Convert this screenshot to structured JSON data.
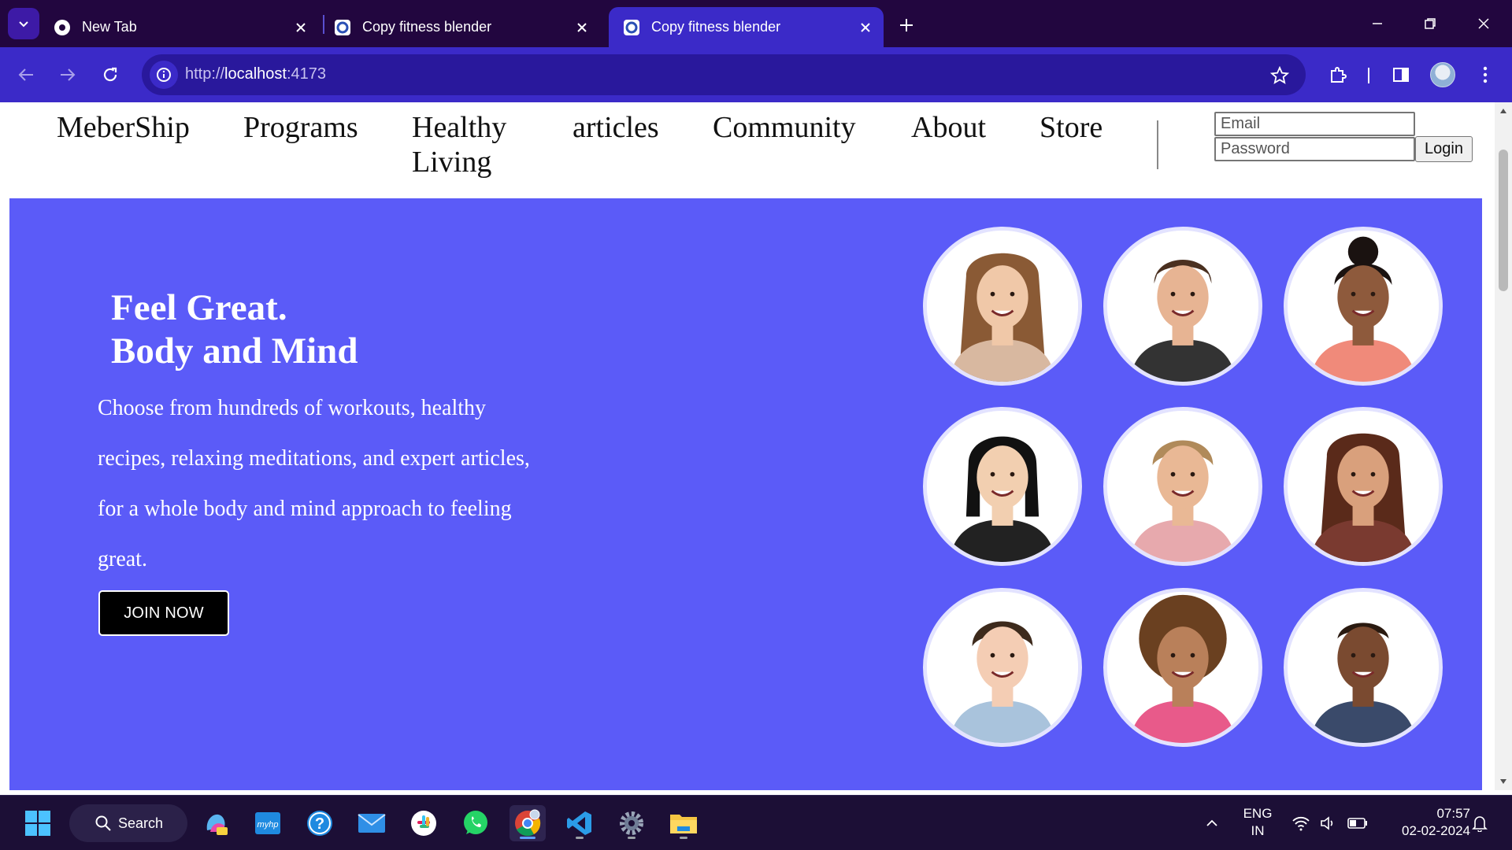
{
  "browser": {
    "tabs": [
      {
        "title": "New Tab",
        "active": false
      },
      {
        "title": "Copy fitness blender",
        "active": false
      },
      {
        "title": "Copy fitness blender",
        "active": true
      }
    ],
    "url_scheme": "http://",
    "url_host": "localhost",
    "url_port": ":4173"
  },
  "site": {
    "nav": [
      "MeberShip",
      "Programs",
      "Healthy",
      "Living",
      "articles",
      "Community",
      "About",
      "Store"
    ],
    "login": {
      "email_placeholder": "Email",
      "password_placeholder": "Password",
      "button": "Login"
    },
    "hero": {
      "title_line1": "Feel Great.",
      "title_line2": "Body and Mind",
      "description": "Choose from hundreds of workouts, healthy recipes, relaxing meditations, and expert articles, for a whole body and mind approach to feeling great.",
      "cta": "JOIN NOW",
      "background": "#5b5bf8"
    },
    "trainers": [
      {
        "name": "trainer-1",
        "hair": "#8a5a35",
        "skin": "#f0c8a8",
        "shirt": "#d8b8a0",
        "style": "long"
      },
      {
        "name": "trainer-2",
        "hair": "#4a3020",
        "skin": "#e7b493",
        "shirt": "#333333",
        "style": "short"
      },
      {
        "name": "trainer-3",
        "hair": "#1a1210",
        "skin": "#8e5a3c",
        "shirt": "#f08a7a",
        "style": "bun"
      },
      {
        "name": "trainer-4",
        "hair": "#111111",
        "skin": "#f2cfb0",
        "shirt": "#222222",
        "style": "bob"
      },
      {
        "name": "trainer-5",
        "hair": "#b08a5a",
        "skin": "#e9b895",
        "shirt": "#e7a9ad",
        "style": "back"
      },
      {
        "name": "trainer-6",
        "hair": "#5a2a1a",
        "skin": "#d9a07c",
        "shirt": "#7a3a30",
        "style": "long"
      },
      {
        "name": "trainer-7",
        "hair": "#3d2a1c",
        "skin": "#f4cdb4",
        "shirt": "#a9c3dc",
        "style": "back"
      },
      {
        "name": "trainer-8",
        "hair": "#6a4020",
        "skin": "#b9805a",
        "shirt": "#e85a8a",
        "style": "curly"
      },
      {
        "name": "trainer-9",
        "hair": "#2a1a10",
        "skin": "#7a4a30",
        "shirt": "#3a4a6a",
        "style": "bald"
      }
    ]
  },
  "taskbar": {
    "search_label": "Search",
    "lang_line1": "ENG",
    "lang_line2": "IN",
    "time": "07:57",
    "date": "02-02-2024"
  }
}
